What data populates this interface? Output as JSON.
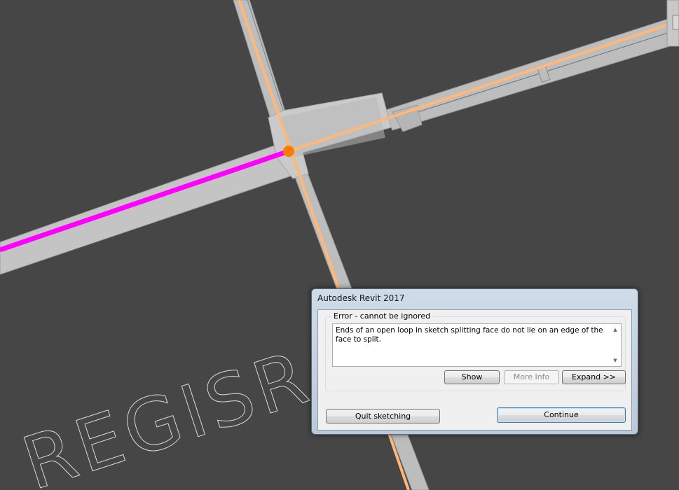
{
  "canvas": {
    "background_color": "#464646",
    "annotation_text": "REGISRA",
    "colors": {
      "wall": "#c0c0c0",
      "highlight_line": "#ff00ff",
      "selected_line": "#ffb878",
      "endpoint": "#ff7a00",
      "text_outline": "#d8d8d8"
    }
  },
  "dialog": {
    "title": "Autodesk Revit 2017",
    "group_label": "Error - cannot be ignored",
    "message": "Ends of an open loop in sketch splitting face do not lie on an edge of the face to split.",
    "buttons": {
      "show": "Show",
      "more_info": "More Info",
      "expand": "Expand >>",
      "quit_sketching": "Quit sketching",
      "continue": "Continue"
    }
  }
}
